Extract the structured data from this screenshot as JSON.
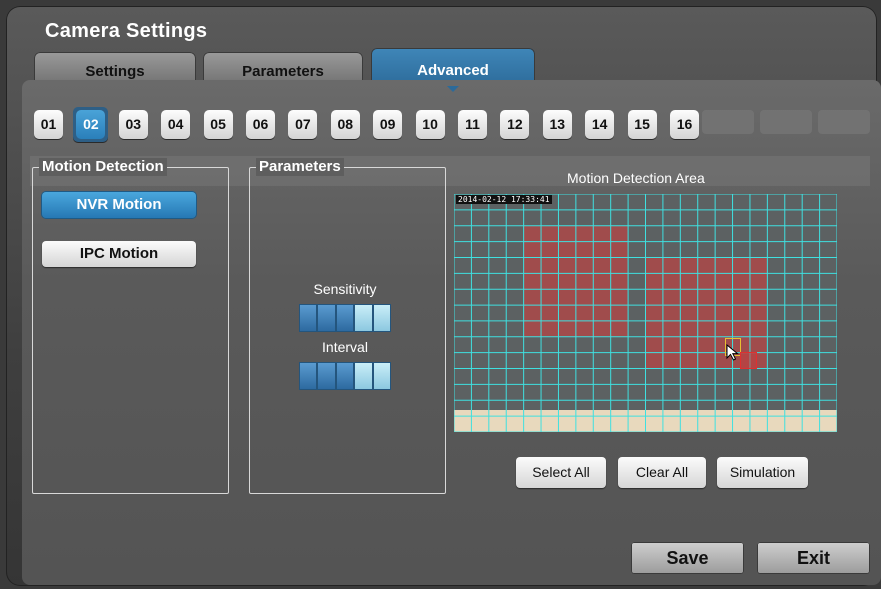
{
  "window": {
    "title": "Camera Settings"
  },
  "tabs": [
    {
      "label": "Settings",
      "active": false
    },
    {
      "label": "Parameters",
      "active": false
    },
    {
      "label": "Advanced",
      "active": true
    }
  ],
  "channels": [
    "01",
    "02",
    "03",
    "04",
    "05",
    "06",
    "07",
    "08",
    "09",
    "10",
    "11",
    "12",
    "13",
    "14",
    "15",
    "16"
  ],
  "active_channel": "02",
  "motion_detection": {
    "legend": "Motion Detection",
    "nvr_button": "NVR Motion",
    "ipc_button": "IPC Motion",
    "selected": "NVR Motion"
  },
  "parameters": {
    "legend": "Parameters",
    "sensitivity_label": "Sensitivity",
    "sensitivity_level": 3,
    "interval_label": "Interval",
    "interval_level": 3,
    "levels_total": 5
  },
  "area": {
    "title": "Motion Detection Area",
    "timestamp": "2014-02-12 17:33:41",
    "columns": 22,
    "rows": 15
  },
  "area_buttons": {
    "select_all": "Select All",
    "clear_all": "Clear All",
    "simulation": "Simulation"
  },
  "footer": {
    "save": "Save",
    "exit": "Exit"
  },
  "colors": {
    "accent": "#2a7fba",
    "grid_line": "#3fe0e0",
    "selected_cell": "#b04848"
  }
}
